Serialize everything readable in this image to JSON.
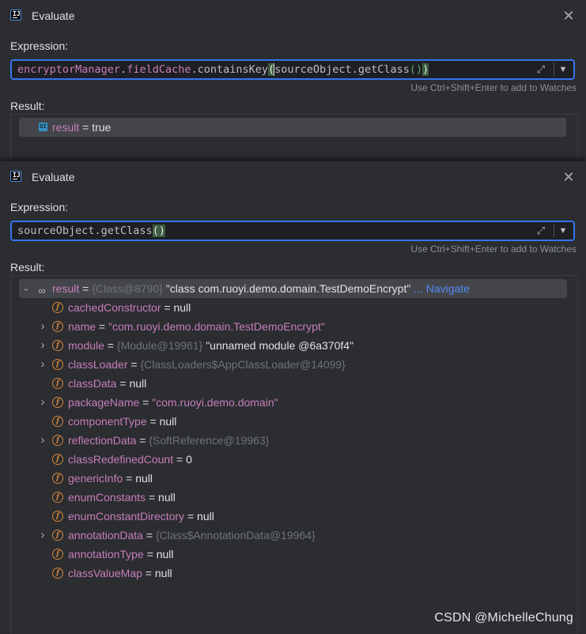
{
  "dialog1": {
    "title": "Evaluate",
    "expression_label": "Expression:",
    "expression": {
      "part1": "encryptorManager",
      "dot1": ".",
      "part2": "fieldCache",
      "dot2": ".",
      "part3": "containsKey",
      "open_paren": "(",
      "part4": "sourceObject.getClass",
      "inner_parens": "()",
      "close_paren": ")"
    },
    "hint": "Use Ctrl+Shift+Enter to add to Watches",
    "result_label": "Result:",
    "result": {
      "icon_text": "OI",
      "name": "result",
      "eq": " = ",
      "value": "true"
    }
  },
  "dialog2": {
    "title": "Evaluate",
    "expression_label": "Expression:",
    "expression": {
      "text": "sourceObject.getClass",
      "parens": "()"
    },
    "hint": "Use Ctrl+Shift+Enter to add to Watches",
    "result_label": "Result:",
    "root": {
      "name": "result",
      "eq": " = ",
      "ref": "{Class@8790}",
      "value": " \"class com.ruoyi.demo.domain.TestDemoEncrypt\"",
      "ellipsis": " ... ",
      "navigate": "Navigate"
    },
    "fields": [
      {
        "name": "cachedConstructor",
        "eq": " = ",
        "ref": "",
        "value": "null",
        "kind": "plain",
        "expandable": false
      },
      {
        "name": "name",
        "eq": " = ",
        "ref": "",
        "value": "\"com.ruoyi.demo.domain.TestDemoEncrypt\"",
        "kind": "str",
        "expandable": true
      },
      {
        "name": "module",
        "eq": " = ",
        "ref": "{Module@19961}",
        "value": " \"unnamed module @6a370f4\"",
        "kind": "plain",
        "expandable": true
      },
      {
        "name": "classLoader",
        "eq": " = ",
        "ref": "{ClassLoaders$AppClassLoader@14099}",
        "value": "",
        "kind": "plain",
        "expandable": true
      },
      {
        "name": "classData",
        "eq": " = ",
        "ref": "",
        "value": "null",
        "kind": "plain",
        "expandable": false
      },
      {
        "name": "packageName",
        "eq": " = ",
        "ref": "",
        "value": "\"com.ruoyi.demo.domain\"",
        "kind": "str",
        "expandable": true
      },
      {
        "name": "componentType",
        "eq": " = ",
        "ref": "",
        "value": "null",
        "kind": "plain",
        "expandable": false
      },
      {
        "name": "reflectionData",
        "eq": " = ",
        "ref": "{SoftReference@19963}",
        "value": "",
        "kind": "plain",
        "expandable": true
      },
      {
        "name": "classRedefinedCount",
        "eq": " = ",
        "ref": "",
        "value": "0",
        "kind": "plain",
        "expandable": false
      },
      {
        "name": "genericInfo",
        "eq": " = ",
        "ref": "",
        "value": "null",
        "kind": "plain",
        "expandable": false
      },
      {
        "name": "enumConstants",
        "eq": " = ",
        "ref": "",
        "value": "null",
        "kind": "plain",
        "expandable": false
      },
      {
        "name": "enumConstantDirectory",
        "eq": " = ",
        "ref": "",
        "value": "null",
        "kind": "plain",
        "expandable": false
      },
      {
        "name": "annotationData",
        "eq": " = ",
        "ref": "{Class$AnnotationData@19964}",
        "value": "",
        "kind": "plain",
        "expandable": true
      },
      {
        "name": "annotationType",
        "eq": " = ",
        "ref": "",
        "value": "null",
        "kind": "plain",
        "expandable": false
      },
      {
        "name": "classValueMap",
        "eq": " = ",
        "ref": "",
        "value": "null",
        "kind": "plain",
        "expandable": false
      }
    ]
  },
  "watermark": "CSDN @MichelleChung",
  "colors": {
    "accent": "#3574f0",
    "field_name": "#c77dbb",
    "ref_grey": "#6f737a",
    "link": "#548af7",
    "field_icon": "#d4843e"
  }
}
